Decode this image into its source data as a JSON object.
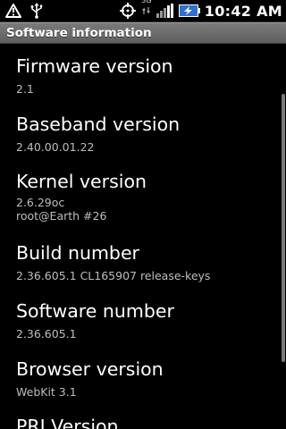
{
  "status_bar": {
    "time": "10:42 AM",
    "network_type": "3G",
    "left_icons": [
      "warning-icon",
      "usb-icon"
    ],
    "right_icons": [
      "gps-icon",
      "data-arrows-icon",
      "signal-bars-icon",
      "battery-charging-icon"
    ]
  },
  "title_bar": {
    "title": "Software information"
  },
  "items": [
    {
      "title": "Firmware version",
      "summary": "2.1"
    },
    {
      "title": "Baseband version",
      "summary": "2.40.00.01.22"
    },
    {
      "title": "Kernel version",
      "summary": "2.6.29oc",
      "summary_line2": "root@Earth #26"
    },
    {
      "title": "Build number",
      "summary": "2.36.605.1 CL165907 release-keys"
    },
    {
      "title": "Software number",
      "summary": "2.36.605.1"
    },
    {
      "title": "Browser version",
      "summary": "WebKit 3.1"
    },
    {
      "title": "PRI Version"
    }
  ]
}
